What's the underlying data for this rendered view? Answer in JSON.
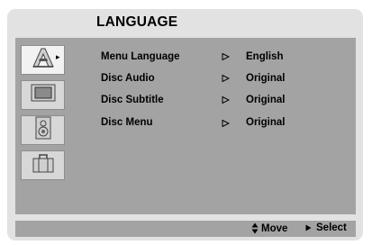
{
  "header": {
    "title": "LANGUAGE"
  },
  "sidebar": {
    "tabs": [
      {
        "name": "language",
        "icon": "language-icon",
        "selected": true
      },
      {
        "name": "display",
        "icon": "tv-icon",
        "selected": false
      },
      {
        "name": "audio",
        "icon": "speaker-icon",
        "selected": false
      },
      {
        "name": "other",
        "icon": "briefcase-icon",
        "selected": false
      }
    ],
    "selected_indicator": "▸"
  },
  "menu": {
    "rows": [
      {
        "label": "Menu Language",
        "value": "English"
      },
      {
        "label": "Disc Audio",
        "value": "Original"
      },
      {
        "label": "Disc Subtitle",
        "value": "Original"
      },
      {
        "label": "Disc Menu",
        "value": "Original"
      }
    ]
  },
  "footer": {
    "move_label": "Move",
    "move_icon": "up-down-icon",
    "select_label": "Select",
    "select_icon": "play-icon"
  },
  "colors": {
    "panel": "#a3a3a3",
    "frame": "#e2e2e2"
  }
}
